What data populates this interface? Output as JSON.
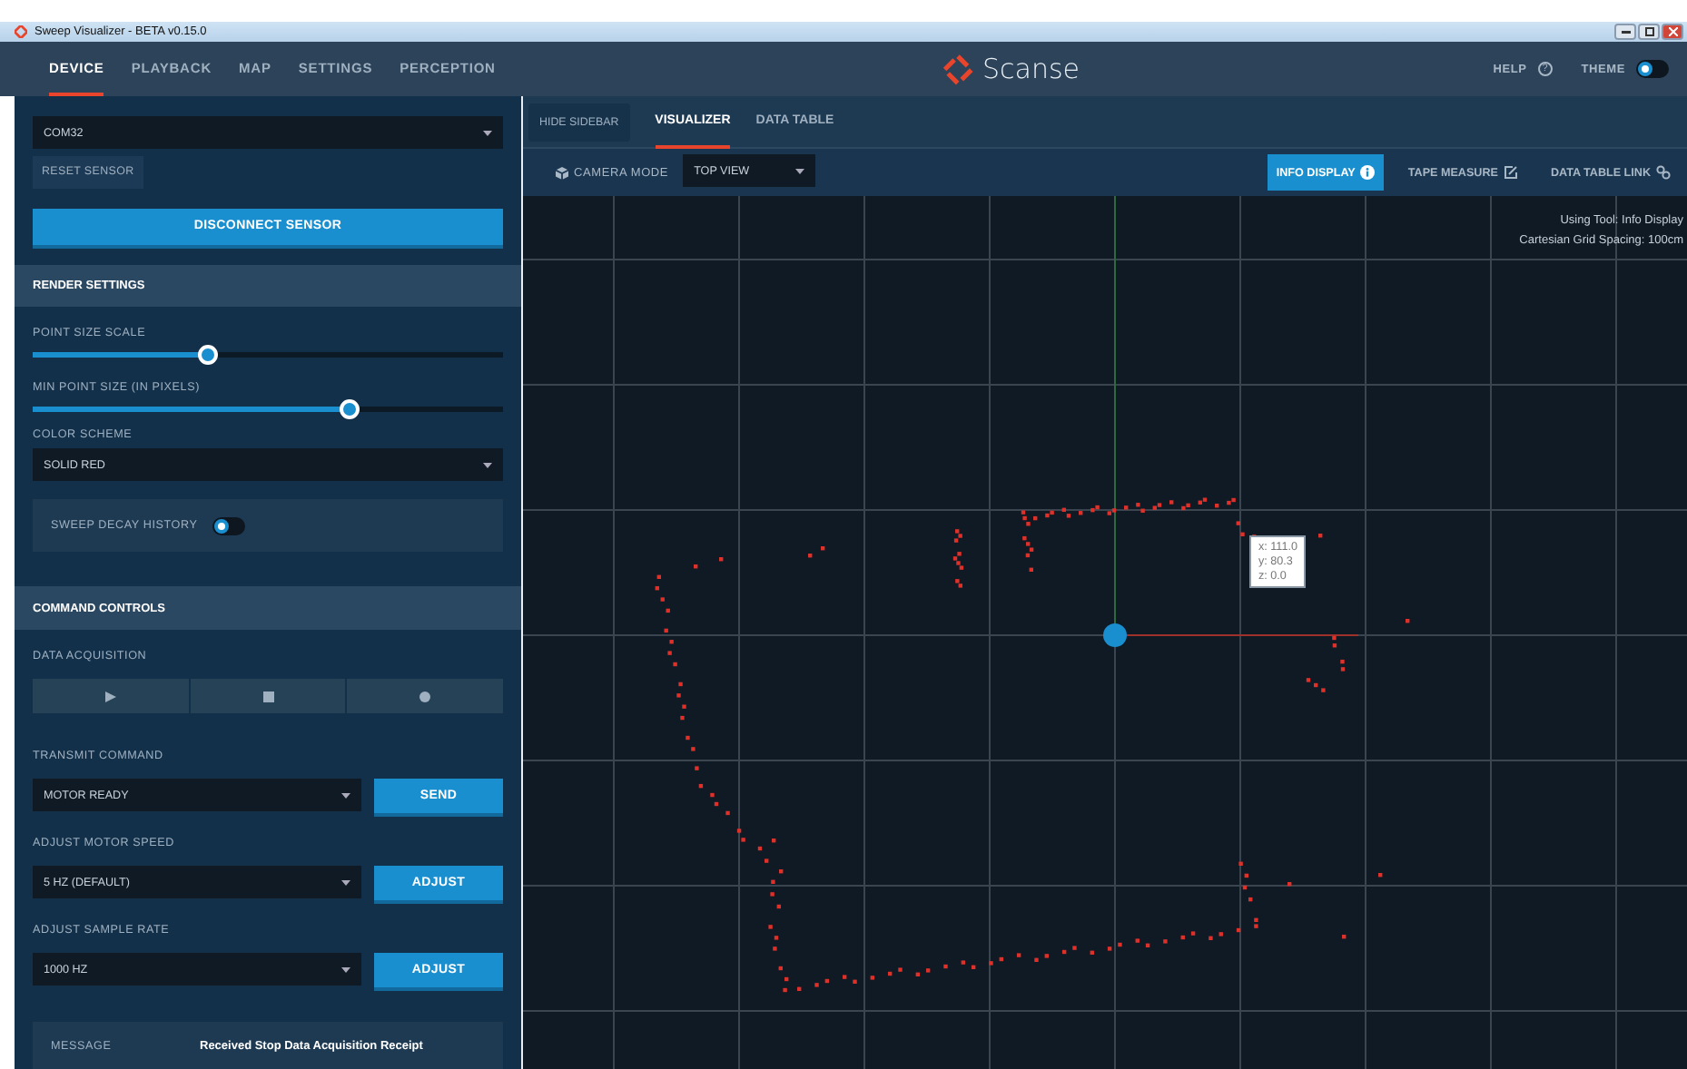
{
  "window": {
    "title": "Sweep Visualizer - BETA v0.15.0"
  },
  "nav": {
    "tabs": [
      {
        "label": "DEVICE",
        "selected": true
      },
      {
        "label": "PLAYBACK",
        "selected": false
      },
      {
        "label": "MAP",
        "selected": false
      },
      {
        "label": "SETTINGS",
        "selected": false
      },
      {
        "label": "PERCEPTION",
        "selected": false
      }
    ],
    "logo": "Scanse",
    "help": "HELP",
    "help_icon": "?",
    "theme_label": "THEME",
    "theme_toggle": {
      "on": false
    }
  },
  "sidebar": {
    "port_select": "COM32",
    "reset_button": "RESET SENSOR",
    "disconnect_button": "DISCONNECT SENSOR",
    "render_settings": {
      "title": "RENDER SETTINGS",
      "sliders": [
        {
          "label": "POINT SIZE SCALE",
          "level": 0.37
        },
        {
          "label": "MIN POINT SIZE (IN PIXELS)",
          "level": 0.67
        }
      ],
      "color_scheme": {
        "label": "COLOR SCHEME",
        "value": "SOLID RED"
      },
      "sweep_decay": {
        "label": "SWEEP DECAY HISTORY",
        "on": false
      }
    },
    "command_controls": {
      "title": "COMMAND CONTROLS",
      "data_acquisition": {
        "label": "DATA ACQUISITION",
        "buttons": [
          {
            "kind": "play"
          },
          {
            "kind": "stop"
          },
          {
            "kind": "record"
          }
        ]
      },
      "rows": [
        {
          "label": "TRANSMIT COMMAND",
          "value": "MOTOR READY",
          "button": "SEND"
        },
        {
          "label": "ADJUST MOTOR SPEED",
          "value": "5 HZ (DEFAULT)",
          "button": "ADJUST"
        },
        {
          "label": "ADJUST SAMPLE RATE",
          "value": "1000 HZ",
          "button": "ADJUST"
        }
      ],
      "message": {
        "label": "MESSAGE",
        "text": "Received Stop Data Acquisition Receipt"
      }
    }
  },
  "main": {
    "hide_sidebar": "HIDE SIDEBAR",
    "tabs": [
      {
        "label": "VISUALIZER",
        "selected": true
      },
      {
        "label": "DATA TABLE",
        "selected": false
      }
    ],
    "camera_mode": {
      "label": "CAMERA MODE",
      "value": "TOP VIEW"
    },
    "tools": [
      {
        "label": "INFO DISPLAY",
        "kind": "info",
        "selected": true
      },
      {
        "label": "TAPE MEASURE",
        "kind": "tape",
        "selected": false
      },
      {
        "label": "DATA TABLE LINK",
        "kind": "link",
        "selected": false
      }
    ],
    "canvas": {
      "status": [
        "Using Tool: Info Display",
        "Cartesian Grid Spacing: 100cm"
      ],
      "tooltip": [
        "x: 111.0",
        "y: 80.3",
        "z: 0.0"
      ]
    }
  }
}
